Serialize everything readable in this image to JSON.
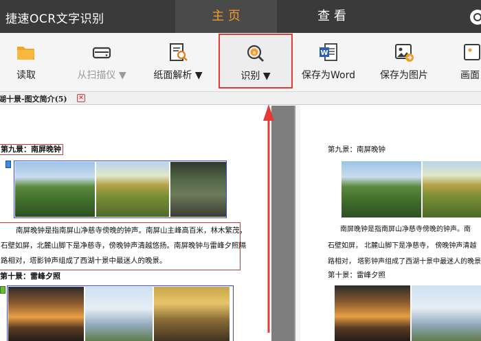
{
  "app": {
    "title": "捷速OCR文字识别"
  },
  "tabs": [
    {
      "label": "主 页",
      "active": true
    },
    {
      "label": "查 看",
      "active": false
    }
  ],
  "ribbon": {
    "buttons": [
      {
        "id": "open",
        "label": "读取",
        "icon": "folder-icon",
        "enabled": true,
        "dropdown": false
      },
      {
        "id": "scan",
        "label": "从扫描仪 ▼",
        "icon": "scanner-icon",
        "enabled": false,
        "dropdown": true
      },
      {
        "id": "parse",
        "label": "纸面解析 ▼",
        "icon": "document-magnify-icon",
        "enabled": true,
        "dropdown": true
      },
      {
        "id": "recognize",
        "label": "识别 ▼",
        "icon": "ocr-recognize-icon",
        "enabled": true,
        "dropdown": true,
        "highlighted": true
      },
      {
        "id": "save_word",
        "label": "保存为Word",
        "icon": "word-icon",
        "enabled": true,
        "dropdown": false
      },
      {
        "id": "save_image",
        "label": "保存为图片",
        "icon": "image-save-icon",
        "enabled": true,
        "dropdown": false
      },
      {
        "id": "screen",
        "label": "画面",
        "icon": "screen-icon",
        "enabled": true,
        "dropdown": false
      }
    ]
  },
  "doc_tab": {
    "label": "湖十景-图文简介(5)"
  },
  "left_page": {
    "heading9": "第九景：南屏晚钟",
    "para_lines": [
      "南屏晚钟是指南屏山净慈寺傍晚的钟声。南屏山主峰高百米，林木繁茂，",
      "石壁如屏，北麓山脚下是净慈寺，傍晚钟声清越悠扬。南屏晚钟与雷峰夕照隔",
      "路相对，塔影钟声组成了西湖十景中最迷人的晚景。"
    ],
    "heading10": "第十景：雷峰夕照"
  },
  "right_page": {
    "heading9": "第九景：南屏晚钟",
    "para_lines": [
      "南屏晚钟是指南屏山净慈寺傍晚的钟声。南",
      "石壁如屏， 北麓山脚下是净慈寺， 傍晚钟声清越",
      "路相对， 塔影钟声组成了西湖十景中最迷人的晚景"
    ],
    "heading10": "第十景：雷峰夕照"
  },
  "colors": {
    "titlebar": "#3a3a3a",
    "active_tab_text": "#f39c2b",
    "highlight_border": "#e53935",
    "text_region": "#c23b3b",
    "image_region": "#3344cc"
  }
}
